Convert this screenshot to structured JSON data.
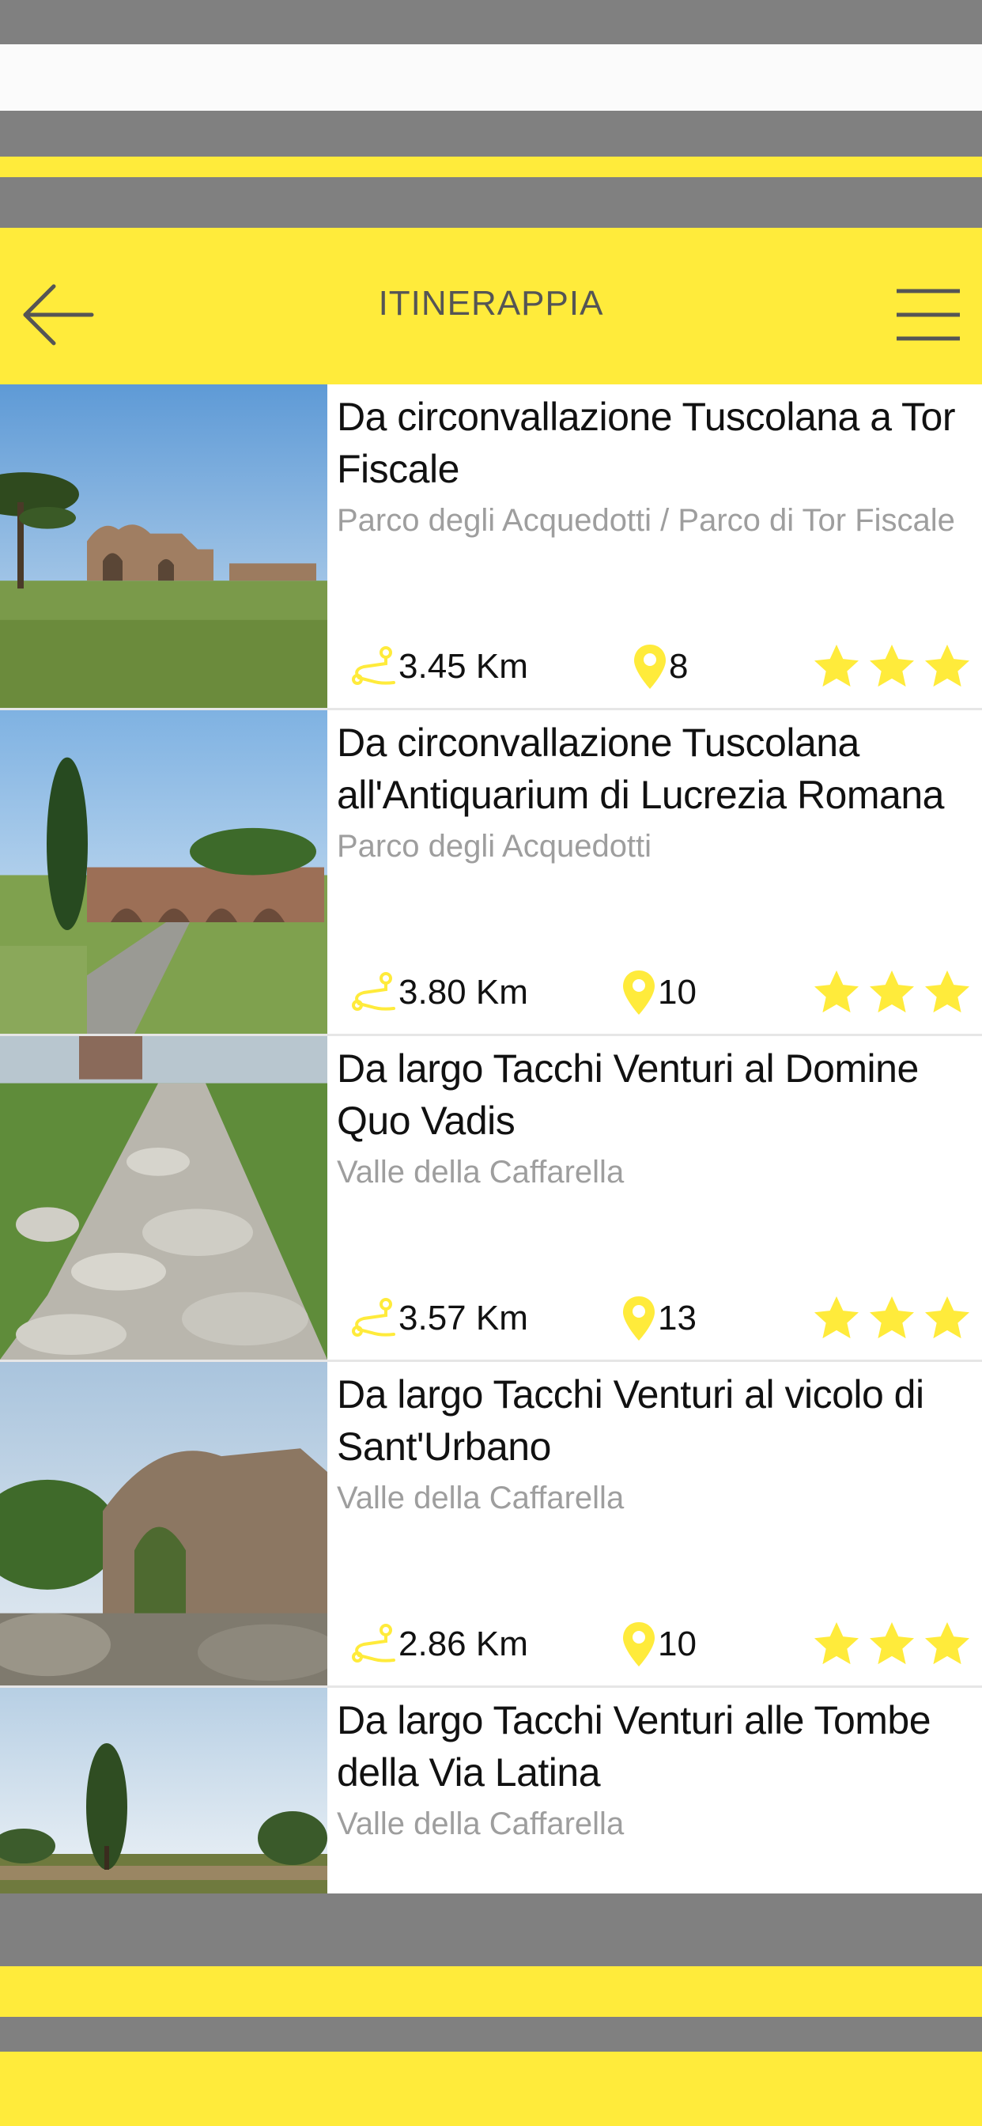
{
  "app": {
    "title": "ITINERAPPIA"
  },
  "colors": {
    "accent": "#ffeb3b",
    "chrome_gray": "#808080",
    "star": "#ffeb3b",
    "subtitle": "#9e9e9e"
  },
  "icons": {
    "back": "arrow-left-icon",
    "menu": "hamburger-menu-icon",
    "distance": "route-icon",
    "points": "map-pin-icon",
    "rating": "star-icon"
  },
  "itineraries": [
    {
      "title": "Da circonvallazione Tuscolana a Tor Fiscale",
      "subtitle": "Parco degli Acquedotti / Parco di Tor Fiscale",
      "distance": "3.45 Km",
      "points": "8",
      "rating": 3
    },
    {
      "title": "Da circonvallazione Tuscolana all'Antiquarium di Lucrezia Romana",
      "subtitle": "Parco degli Acquedotti",
      "distance": "3.80 Km",
      "points": "10",
      "rating": 3
    },
    {
      "title": "Da largo Tacchi Venturi al Domine Quo Vadis",
      "subtitle": "Valle della Caffarella",
      "distance": "3.57 Km",
      "points": "13",
      "rating": 3
    },
    {
      "title": "Da largo Tacchi Venturi al vicolo di Sant'Urbano",
      "subtitle": "Valle della Caffarella",
      "distance": "2.86 Km",
      "points": "10",
      "rating": 3
    },
    {
      "title": "Da largo Tacchi Venturi alle Tombe della Via Latina",
      "subtitle": "Valle della Caffarella"
    }
  ]
}
